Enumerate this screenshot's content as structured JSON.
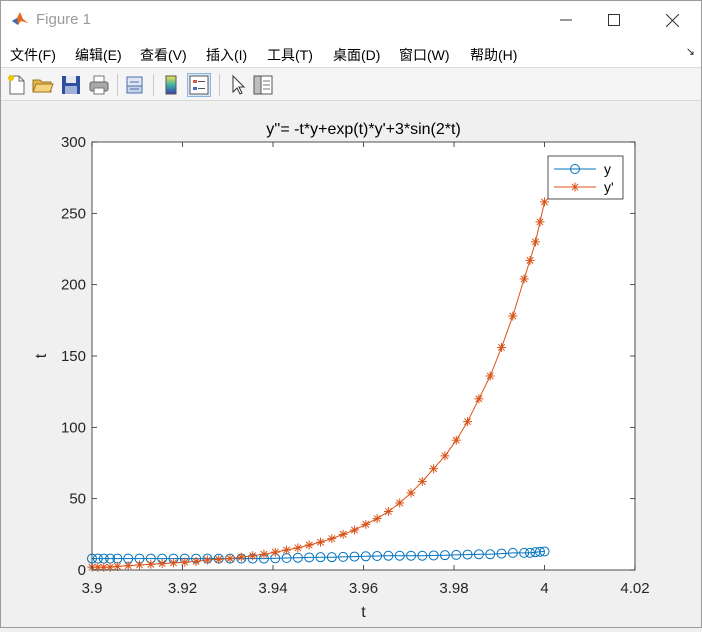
{
  "window": {
    "title": "Figure 1",
    "icon": "matlab-logo-icon",
    "controls": [
      "minimize-icon",
      "maximize-icon",
      "close-icon"
    ]
  },
  "menu": {
    "items": [
      "文件(F)",
      "编辑(E)",
      "查看(V)",
      "插入(I)",
      "工具(T)",
      "桌面(D)",
      "窗口(W)",
      "帮助(H)"
    ],
    "corner_glyph": "↘"
  },
  "toolbar": {
    "icons": [
      "new-figure-icon",
      "open-file-icon",
      "save-icon",
      "print-icon",
      "link-plot-icon",
      "colorbar-icon",
      "legend-icon",
      "pointer-icon",
      "property-inspector-icon"
    ]
  },
  "colors": {
    "series_y": "#0072BD",
    "series_yp": "#D95319"
  },
  "chart_data": {
    "type": "line",
    "title": "y''= -t*y+exp(t)*y'+3*sin(2*t)",
    "xlabel": "t",
    "ylabel": "t",
    "xlim": [
      3.9,
      4.02
    ],
    "ylim": [
      0,
      300
    ],
    "xticks": [
      "3.9",
      "3.92",
      "3.94",
      "3.96",
      "3.98",
      "4",
      "4.02"
    ],
    "yticks": [
      "0",
      "50",
      "100",
      "150",
      "200",
      "250",
      "300"
    ],
    "grid": false,
    "legend_position": "top-right",
    "series": [
      {
        "name": "y",
        "marker": "circle",
        "x": [
          3.9,
          3.9013,
          3.9026,
          3.904,
          3.9056,
          3.908,
          3.9105,
          3.913,
          3.9155,
          3.918,
          3.9205,
          3.923,
          3.9255,
          3.928,
          3.9305,
          3.933,
          3.9355,
          3.938,
          3.9405,
          3.943,
          3.9455,
          3.948,
          3.9505,
          3.953,
          3.9555,
          3.958,
          3.9605,
          3.963,
          3.9655,
          3.968,
          3.9705,
          3.973,
          3.9755,
          3.978,
          3.9805,
          3.983,
          3.9855,
          3.988,
          3.9905,
          3.993,
          3.9955,
          3.9968,
          3.998,
          3.999,
          4.0
        ],
        "y": [
          8,
          8,
          8,
          8,
          8,
          8,
          8,
          8,
          8,
          8,
          8,
          8,
          8,
          8,
          8,
          8,
          8,
          8,
          8.2,
          8.4,
          8.6,
          8.8,
          9,
          9,
          9.2,
          9.4,
          9.6,
          9.8,
          10,
          10,
          10,
          10,
          10.2,
          10.4,
          10.6,
          10.8,
          11,
          11,
          11.5,
          12,
          12,
          12,
          12.5,
          12.8,
          13
        ]
      },
      {
        "name": "y'",
        "marker": "asterisk",
        "x": [
          3.9,
          3.9013,
          3.9026,
          3.904,
          3.9056,
          3.908,
          3.9105,
          3.913,
          3.9155,
          3.918,
          3.9205,
          3.923,
          3.9255,
          3.928,
          3.9305,
          3.933,
          3.9355,
          3.938,
          3.9405,
          3.943,
          3.9455,
          3.948,
          3.9505,
          3.953,
          3.9555,
          3.958,
          3.9605,
          3.963,
          3.9655,
          3.968,
          3.9705,
          3.973,
          3.9755,
          3.978,
          3.9805,
          3.983,
          3.9855,
          3.988,
          3.9905,
          3.993,
          3.9955,
          3.9968,
          3.998,
          3.999,
          4.0
        ],
        "y": [
          2,
          2,
          2,
          2,
          2.5,
          3,
          3.5,
          4,
          4.5,
          5,
          5.5,
          6,
          7,
          7.5,
          8,
          9,
          10,
          11,
          12.5,
          14,
          15.5,
          17.5,
          19.5,
          22,
          25,
          28,
          32,
          36,
          41,
          47,
          54,
          62,
          71,
          80,
          91,
          104,
          120,
          136,
          156,
          178,
          204,
          217,
          230,
          244,
          258
        ]
      }
    ]
  }
}
